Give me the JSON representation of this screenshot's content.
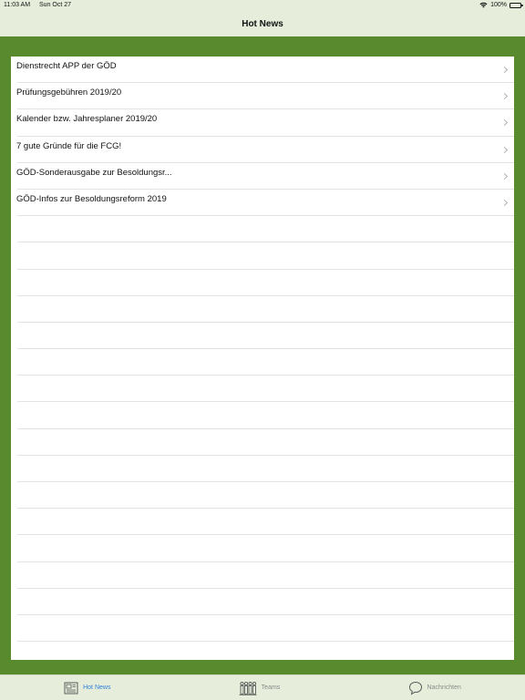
{
  "status": {
    "time": "11:03 AM",
    "date": "Sun Oct 27",
    "battery": "100%"
  },
  "nav": {
    "title": "Hot News"
  },
  "list": {
    "items": [
      {
        "label": "Dienstrecht APP der GÖD"
      },
      {
        "label": "Prüfungsgebühren 2019/20"
      },
      {
        "label": "Kalender bzw. Jahresplaner 2019/20"
      },
      {
        "label": "7 gute Gründe für die FCG!"
      },
      {
        "label": "GÖD-Sonderausgabe zur Besoldungsr..."
      },
      {
        "label": "GÖD-Infos zur Besoldungsreform 2019"
      }
    ]
  },
  "tabs": [
    {
      "label": "Hot News",
      "icon": "newspaper-icon",
      "active": true
    },
    {
      "label": "Teams",
      "icon": "team-icon",
      "active": false
    },
    {
      "label": "Nachrichten",
      "icon": "chat-bubble-icon",
      "active": false
    }
  ],
  "colors": {
    "background": "#5a8a2e",
    "bars": "#e6eedb",
    "accent": "#2f7fd8"
  }
}
